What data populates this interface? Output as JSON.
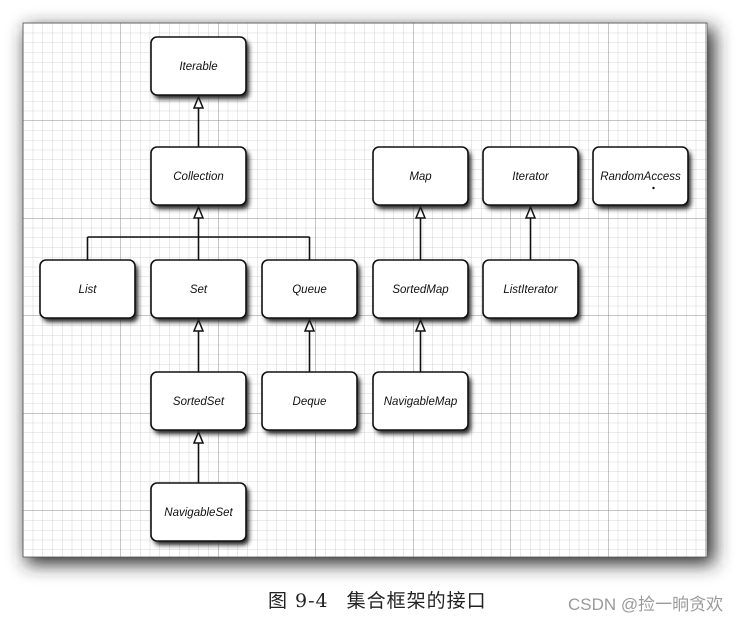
{
  "figure": {
    "caption_number": "图 9-4",
    "caption_text": "集合框架的接口",
    "watermark": "CSDN @捡一晌贪欢"
  },
  "diagram": {
    "nodes": [
      {
        "id": "iterable",
        "label": "Iterable",
        "row": 0,
        "col": 1
      },
      {
        "id": "collection",
        "label": "Collection",
        "row": 1,
        "col": 1
      },
      {
        "id": "map",
        "label": "Map",
        "row": 1,
        "col": 3
      },
      {
        "id": "iterator",
        "label": "Iterator",
        "row": 1,
        "col": 4
      },
      {
        "id": "randomaccess",
        "label": "RandomAccess",
        "row": 1,
        "col": 5,
        "dot": true
      },
      {
        "id": "list",
        "label": "List",
        "row": 2,
        "col": 0
      },
      {
        "id": "set",
        "label": "Set",
        "row": 2,
        "col": 1
      },
      {
        "id": "queue",
        "label": "Queue",
        "row": 2,
        "col": 2
      },
      {
        "id": "sortedmap",
        "label": "SortedMap",
        "row": 2,
        "col": 3
      },
      {
        "id": "listiterator",
        "label": "ListIterator",
        "row": 2,
        "col": 4
      },
      {
        "id": "sortedset",
        "label": "SortedSet",
        "row": 3,
        "col": 1
      },
      {
        "id": "deque",
        "label": "Deque",
        "row": 3,
        "col": 2
      },
      {
        "id": "navigablemap",
        "label": "NavigableMap",
        "row": 3,
        "col": 3
      },
      {
        "id": "navigableset",
        "label": "NavigableSet",
        "row": 4,
        "col": 1
      }
    ],
    "edges": [
      {
        "from": "collection",
        "to": "iterable"
      },
      {
        "from": "list",
        "to": "collection"
      },
      {
        "from": "set",
        "to": "collection"
      },
      {
        "from": "queue",
        "to": "collection"
      },
      {
        "from": "sortedset",
        "to": "set"
      },
      {
        "from": "navigableset",
        "to": "sortedset"
      },
      {
        "from": "deque",
        "to": "queue"
      },
      {
        "from": "sortedmap",
        "to": "map"
      },
      {
        "from": "navigablemap",
        "to": "sortedmap"
      },
      {
        "from": "listiterator",
        "to": "iterator"
      }
    ],
    "colors": {
      "paper": "#ffffff",
      "grid_minor": "#c8c8c8",
      "grid_major": "#8a8a8a",
      "box_stroke": "#111111",
      "shadow": "#3a3a3a"
    }
  }
}
